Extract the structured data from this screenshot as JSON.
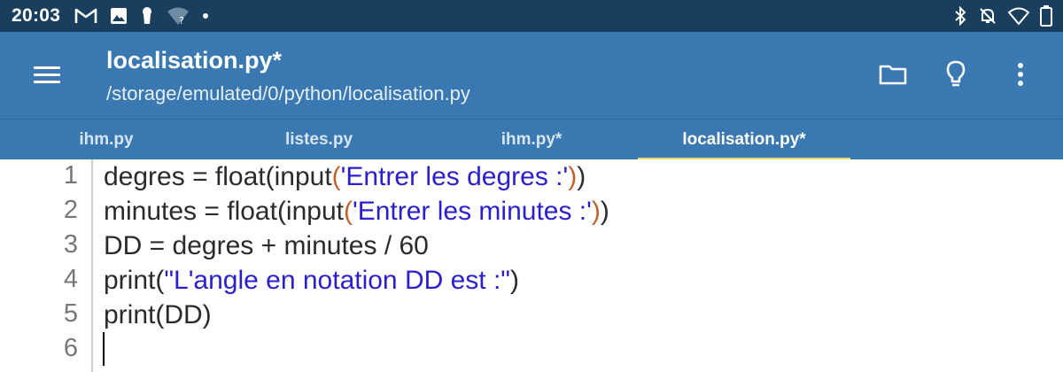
{
  "status_bar": {
    "time": "20:03",
    "left_icons": [
      "gmail-icon",
      "image-icon",
      "keyhole-icon",
      "wifi-question-icon",
      "dot-icon"
    ],
    "right_icons": [
      "bluetooth-icon",
      "bell-off-icon",
      "wifi-icon",
      "battery-icon"
    ]
  },
  "app_bar": {
    "title": "localisation.py*",
    "subtitle": "/storage/emulated/0/python/localisation.py",
    "actions": [
      "folder-icon",
      "lightbulb-icon",
      "more-vert-icon"
    ]
  },
  "tabs": [
    {
      "label": "ihm.py",
      "active": false
    },
    {
      "label": "listes.py",
      "active": false
    },
    {
      "label": "ihm.py*",
      "active": false
    },
    {
      "label": "localisation.py*",
      "active": true
    }
  ],
  "editor": {
    "lines": [
      {
        "num": "1",
        "parts": [
          {
            "t": "degres = float(input",
            "c": "plain"
          },
          {
            "t": "(",
            "c": "par"
          },
          {
            "t": "'Entrer les degres :'",
            "c": "str"
          },
          {
            "t": ")",
            "c": "par"
          },
          {
            "t": ")",
            "c": "plain"
          }
        ]
      },
      {
        "num": "2",
        "parts": [
          {
            "t": "minutes = float(input",
            "c": "plain"
          },
          {
            "t": "(",
            "c": "par"
          },
          {
            "t": "'Entrer les minutes :'",
            "c": "str"
          },
          {
            "t": ")",
            "c": "par"
          },
          {
            "t": ")",
            "c": "plain"
          }
        ]
      },
      {
        "num": "3",
        "parts": [
          {
            "t": "DD = degres + minutes / 60",
            "c": "plain"
          }
        ]
      },
      {
        "num": "4",
        "parts": [
          {
            "t": "print(",
            "c": "plain"
          },
          {
            "t": "\"L'angle en notation DD est :\"",
            "c": "str"
          },
          {
            "t": ")",
            "c": "plain"
          }
        ]
      },
      {
        "num": "5",
        "parts": [
          {
            "t": "print(DD)",
            "c": "plain"
          }
        ]
      },
      {
        "num": "6",
        "parts": []
      }
    ]
  },
  "colors": {
    "status_bar": "#1a3f5e",
    "app_bar": "#3a78b2",
    "tab_indicator": "#f2d96b",
    "string": "#2a1fd0",
    "paren": "#c2612b"
  }
}
